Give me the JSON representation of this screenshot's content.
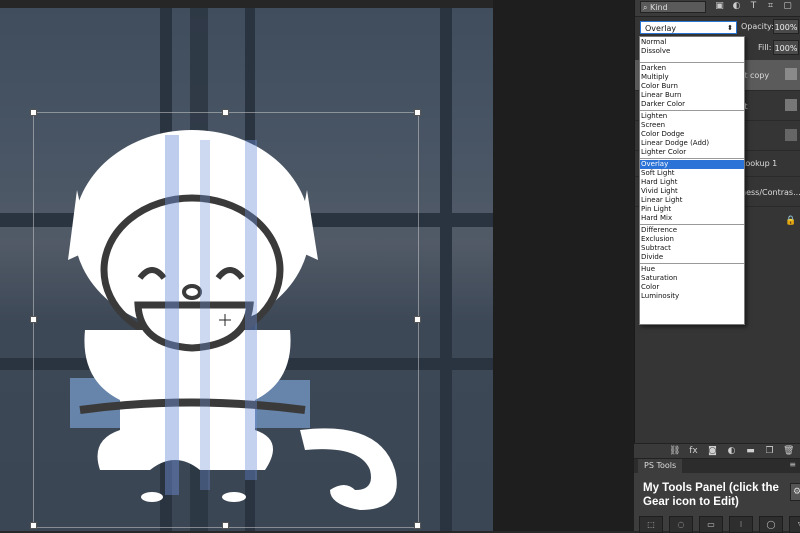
{
  "layers_panel": {
    "kind_filter": "Kind",
    "blend_mode_selected": "Overlay",
    "opacity_label": "Opacity:",
    "opacity_value": "100%",
    "fill_label": "Fill:",
    "fill_value": "100%",
    "layer_1_name_partial": "ect copy",
    "layer_2_name_partial": "ect",
    "layer_3_name_partial": "Lookup 1",
    "layer_4_name_partial": "ness/Contras..."
  },
  "blend_modes": {
    "group_1": [
      "Normal",
      "Dissolve"
    ],
    "group_2": [
      "Darken",
      "Multiply",
      "Color Burn",
      "Linear Burn",
      "Darker Color"
    ],
    "group_3": [
      "Lighten",
      "Screen",
      "Color Dodge",
      "Linear Dodge (Add)",
      "Lighter Color"
    ],
    "group_4": [
      "Overlay",
      "Soft Light",
      "Hard Light",
      "Vivid Light",
      "Linear Light",
      "Pin Light",
      "Hard Mix"
    ],
    "group_5": [
      "Difference",
      "Exclusion",
      "Subtract",
      "Divide"
    ],
    "group_6": [
      "Hue",
      "Saturation",
      "Color",
      "Luminosity"
    ]
  },
  "ps_tools": {
    "tab_label": "PS Tools",
    "title": "My Tools Panel (click the Gear icon to Edit)"
  },
  "colors": {
    "highlight": "#2b73d6",
    "panel_bg": "#353535"
  }
}
